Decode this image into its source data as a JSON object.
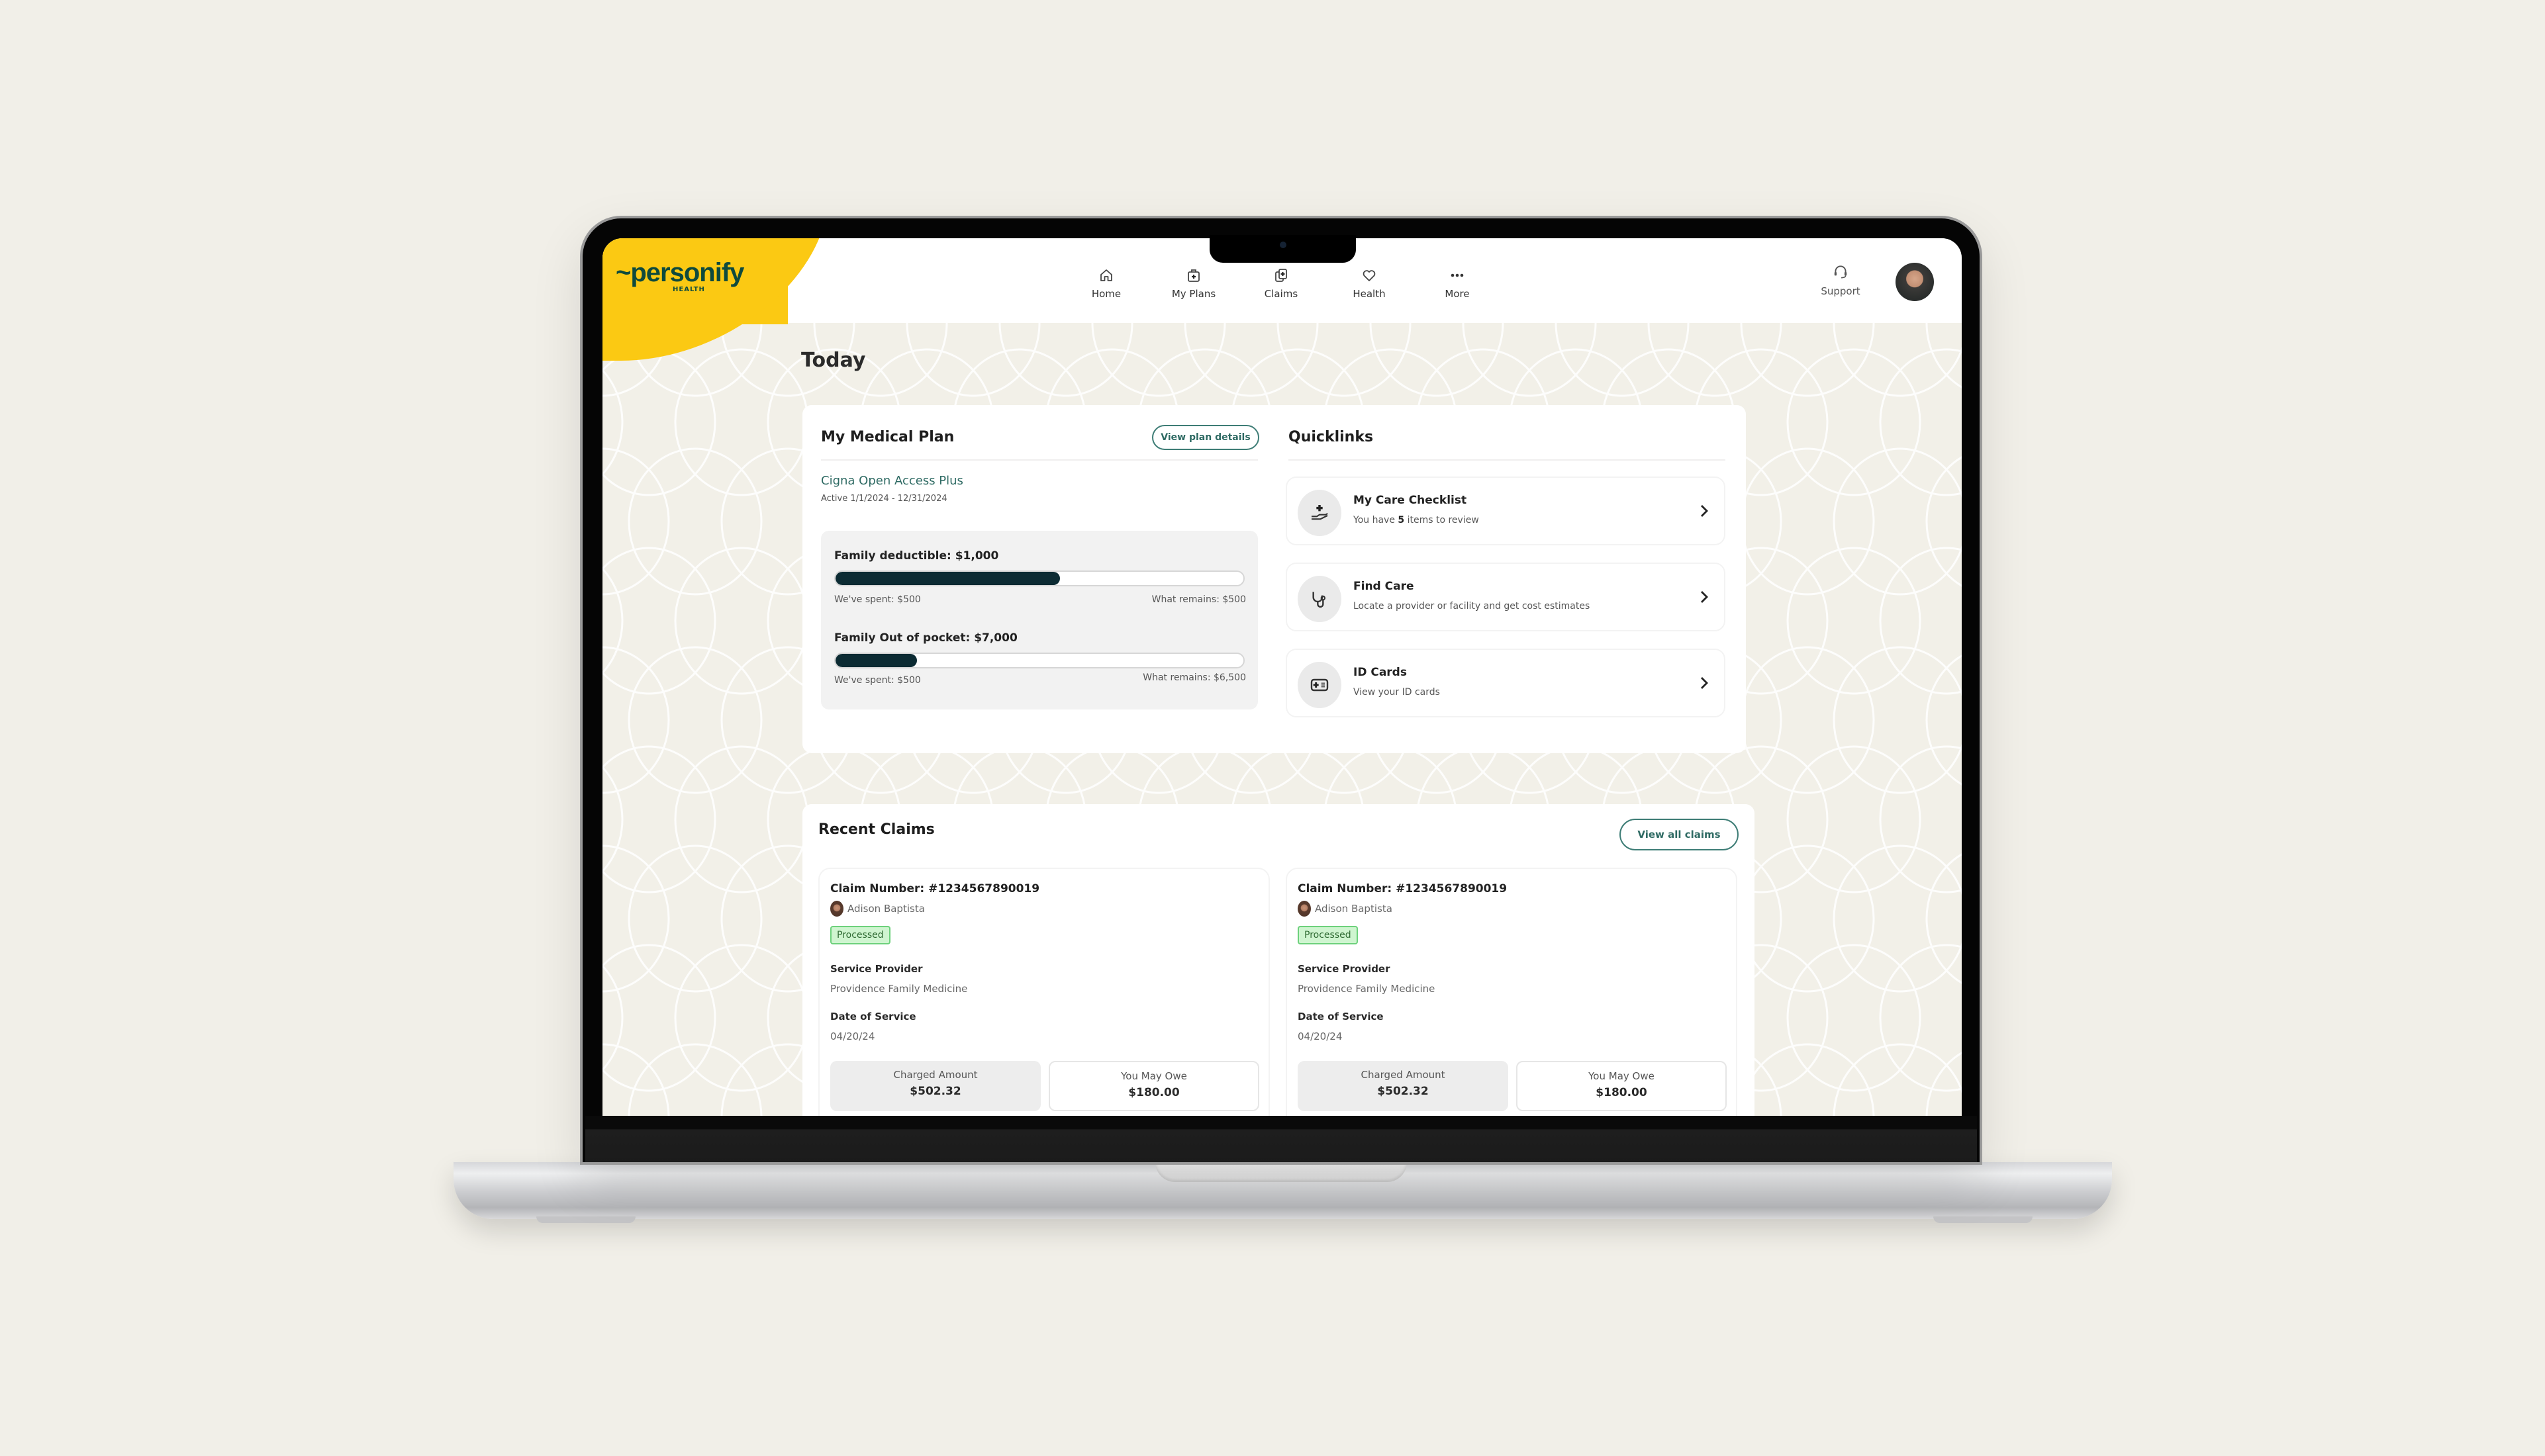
{
  "app": {
    "brand": "personify",
    "brand_sub": "HEALTH",
    "colors": {
      "brand_yellow": "#FBC913",
      "brand_green": "#0E4A3D",
      "accent_teal": "#2E6A63",
      "progress_fill": "#0C2B33",
      "status_green_bg": "#CFF5D0",
      "status_green_border": "#6DD17C",
      "page_bg": "#F2F0E8"
    }
  },
  "nav": {
    "items": [
      {
        "label": "Home",
        "icon": "home-icon"
      },
      {
        "label": "My Plans",
        "icon": "medical-bag-icon"
      },
      {
        "label": "Claims",
        "icon": "claims-documents-icon"
      },
      {
        "label": "Health",
        "icon": "heart-icon"
      },
      {
        "label": "More",
        "icon": "more-dots-icon"
      }
    ],
    "support_label": "Support",
    "avatar": "user-avatar"
  },
  "page": {
    "title": "Today"
  },
  "medical_plan": {
    "title": "My Medical Plan",
    "view_details_label": "View plan details",
    "plan_name": "Cigna Open Access Plus",
    "active_dates": "Active 1/1/2024 - 12/31/2024",
    "accumulators": [
      {
        "title": "Family deductible: $1,000",
        "spent": "We've spent: $500",
        "remains": "What remains: $500",
        "fill_fraction": 0.55
      },
      {
        "title": "Family Out of pocket: $7,000",
        "spent": "We've spent: $500",
        "remains": "What remains: $6,500",
        "fill_fraction": 0.2
      }
    ]
  },
  "quicklinks": {
    "title": "Quicklinks",
    "items": [
      {
        "title": "My Care Checklist",
        "subtitle_pre": "You have ",
        "subtitle_bold": "5",
        "subtitle_post": " items to review",
        "icon": "care-hand-plus-icon"
      },
      {
        "title": "Find Care",
        "subtitle": "Locate a provider or facility and get cost estimates",
        "icon": "stethoscope-icon"
      },
      {
        "title": "ID Cards",
        "subtitle": "View your ID cards",
        "icon": "id-card-icon"
      }
    ]
  },
  "recent_claims": {
    "title": "Recent Claims",
    "view_all_label": "View all claims",
    "claims": [
      {
        "claim_number": "Claim Number: #1234567890019",
        "member": "Adison Baptista",
        "status": "Processed",
        "provider_label": "Service Provider",
        "provider": "Providence Family Medicine",
        "date_label": "Date of Service",
        "date": "04/20/24",
        "charged_label": "Charged Amount",
        "charged": "$502.32",
        "owe_label": "You May Owe",
        "owe": "$180.00"
      },
      {
        "claim_number": "Claim Number: #1234567890019",
        "member": "Adison Baptista",
        "status": "Processed",
        "provider_label": "Service Provider",
        "provider": "Providence Family Medicine",
        "date_label": "Date of Service",
        "date": "04/20/24",
        "charged_label": "Charged Amount",
        "charged": "$502.32",
        "owe_label": "You May Owe",
        "owe": "$180.00"
      }
    ]
  }
}
